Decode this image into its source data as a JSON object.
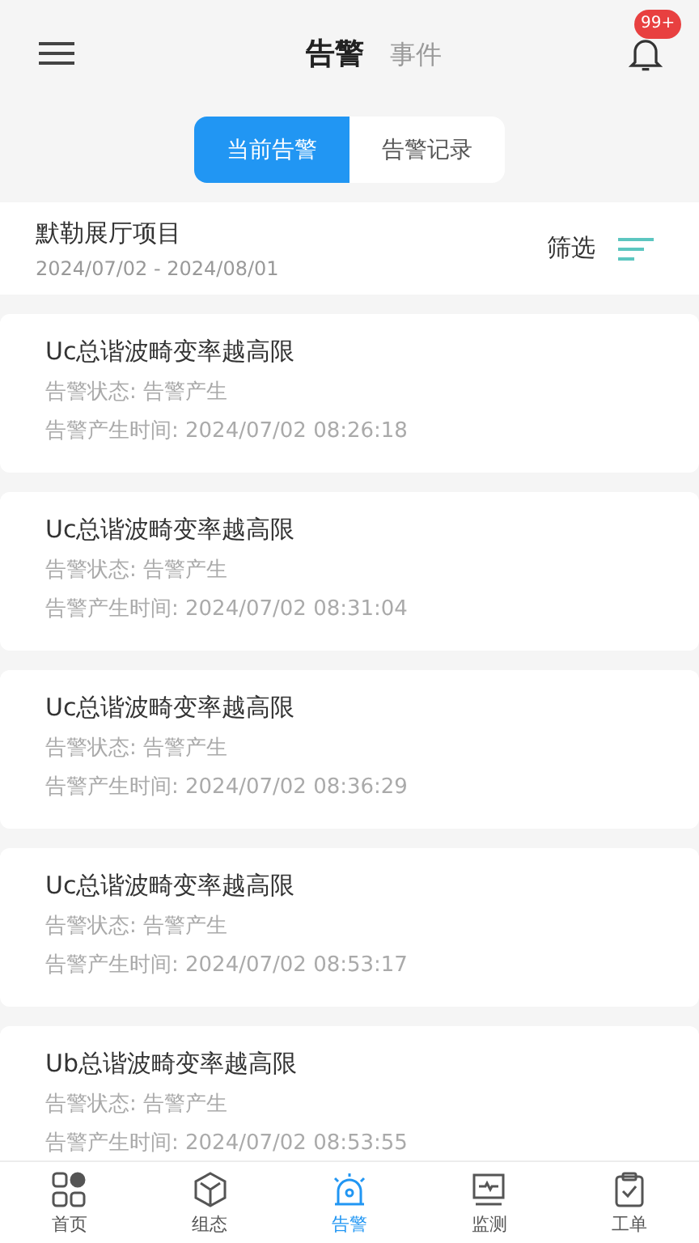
{
  "header": {
    "tabs": [
      {
        "label": "告警",
        "selected": true
      },
      {
        "label": "事件",
        "selected": false
      }
    ],
    "badge": "99+"
  },
  "segments": [
    {
      "label": "当前告警",
      "selected": true
    },
    {
      "label": "告警记录",
      "selected": false
    }
  ],
  "project": {
    "name": "默勒展厅项目",
    "range": "2024/07/02 - 2024/08/01",
    "filter": "筛选"
  },
  "alarms": [
    {
      "title": "Uc总谐波畸变率越高限",
      "status": "告警状态: 告警产生",
      "time": "告警产生时间: 2024/07/02 08:26:18"
    },
    {
      "title": "Uc总谐波畸变率越高限",
      "status": "告警状态: 告警产生",
      "time": "告警产生时间: 2024/07/02 08:31:04"
    },
    {
      "title": "Uc总谐波畸变率越高限",
      "status": "告警状态: 告警产生",
      "time": "告警产生时间: 2024/07/02 08:36:29"
    },
    {
      "title": "Uc总谐波畸变率越高限",
      "status": "告警状态: 告警产生",
      "time": "告警产生时间: 2024/07/02 08:53:17"
    },
    {
      "title": "Ub总谐波畸变率越高限",
      "status": "告警状态: 告警产生",
      "time": "告警产生时间: 2024/07/02 08:53:55"
    }
  ],
  "nav": [
    {
      "kind": "home",
      "label": "首页",
      "selected": false
    },
    {
      "kind": "config",
      "label": "组态",
      "selected": false
    },
    {
      "kind": "alarm",
      "label": "告警",
      "selected": true
    },
    {
      "kind": "monitor",
      "label": "监测",
      "selected": false
    },
    {
      "kind": "order",
      "label": "工单",
      "selected": false
    }
  ]
}
